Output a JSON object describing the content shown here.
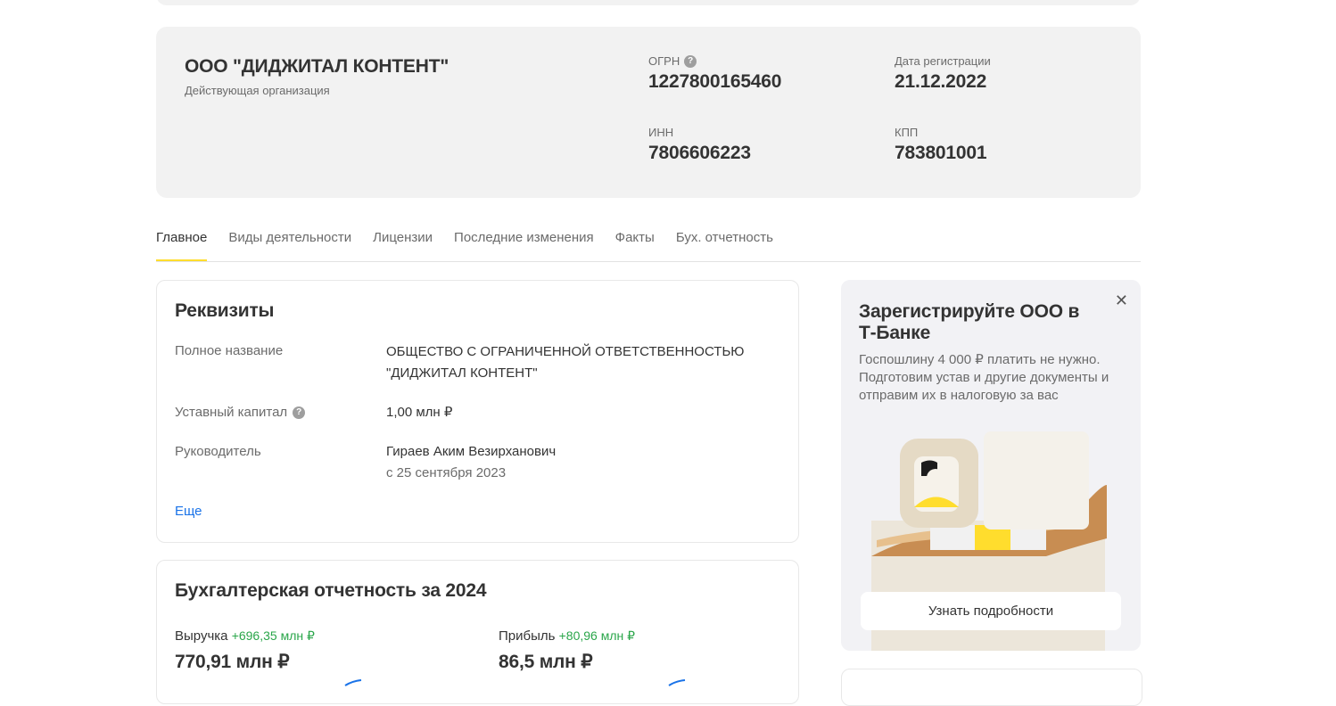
{
  "company": {
    "name": "ООО \"ДИДЖИТАЛ КОНТЕНТ\"",
    "status": "Действующая организация",
    "ogrn_label": "ОГРН",
    "ogrn": "1227800165460",
    "reg_date_label": "Дата регистрации",
    "reg_date": "21.12.2022",
    "inn_label": "ИНН",
    "inn": "7806606223",
    "kpp_label": "КПП",
    "kpp": "783801001"
  },
  "tabs": [
    {
      "label": "Главное",
      "active": true
    },
    {
      "label": "Виды деятельности",
      "active": false
    },
    {
      "label": "Лицензии",
      "active": false
    },
    {
      "label": "Последние изменения",
      "active": false
    },
    {
      "label": "Факты",
      "active": false
    },
    {
      "label": "Бух. отчетность",
      "active": false
    }
  ],
  "requisites": {
    "title": "Реквизиты",
    "full_name_label": "Полное название",
    "full_name": "ОБЩЕСТВО С ОГРАНИЧЕННОЙ ОТВЕТСТВЕННОСТЬЮ \"ДИДЖИТАЛ КОНТЕНТ\"",
    "capital_label": "Уставный капитал",
    "capital": "1,00 млн ₽",
    "head_label": "Руководитель",
    "head_name": "Гираев Аким Везирханович",
    "head_since": "с 25 сентября 2023",
    "more": "Еще"
  },
  "accounting": {
    "title": "Бухгалтерская отчетность за 2024",
    "revenue_label": "Выручка",
    "revenue_delta": "+696,35 млн ₽",
    "revenue_value": "770,91 млн ₽",
    "profit_label": "Прибыль",
    "profit_delta": "+80,96 млн ₽",
    "profit_value": "86,5 млн ₽"
  },
  "promo": {
    "title": "Зарегистрируйте ООО в Т-Банке",
    "text": "Госпошлину 4 000 ₽ платить не нужно. Подготовим устав и другие документы и отправим их в налоговую за вас",
    "button": "Узнать подробности"
  },
  "icons": {
    "help": "question-circle-icon",
    "close": "close-icon"
  },
  "colors": {
    "accent_yellow": "#ffdd2d",
    "link_blue": "#1a73e8",
    "positive_green": "#2aa64a",
    "card_gray": "#f2f2f2"
  }
}
